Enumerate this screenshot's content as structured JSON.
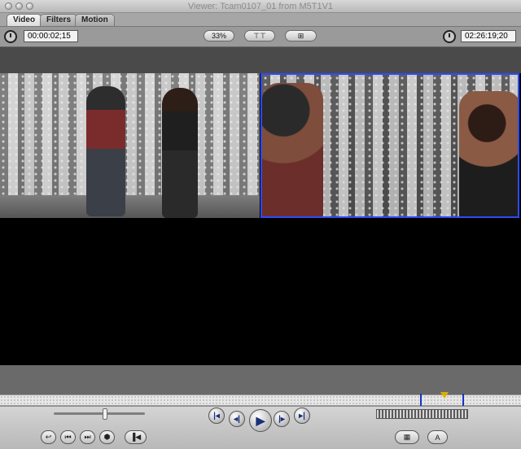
{
  "window": {
    "title": "Viewer: Tcam0107_01 from M5T1V1",
    "tabs": [
      {
        "label": "Video"
      },
      {
        "label": "Filters"
      },
      {
        "label": "Motion"
      }
    ]
  },
  "toolbar": {
    "left_timecode": "00:00:02;15",
    "zoom": "33%",
    "view_popup": "⊤⊤",
    "overlay_popup": "⊞",
    "right_timecode": "02:26:19;20"
  },
  "transport": {
    "slider_value": 0.56,
    "buttons": {
      "prev_edit": "|◂",
      "step_back": "◂|",
      "play": "▶",
      "step_forward": "|▸",
      "next_edit": "▸|"
    }
  },
  "bottom": {
    "menu_text_button": "A",
    "menu_grid_button": "▦"
  }
}
